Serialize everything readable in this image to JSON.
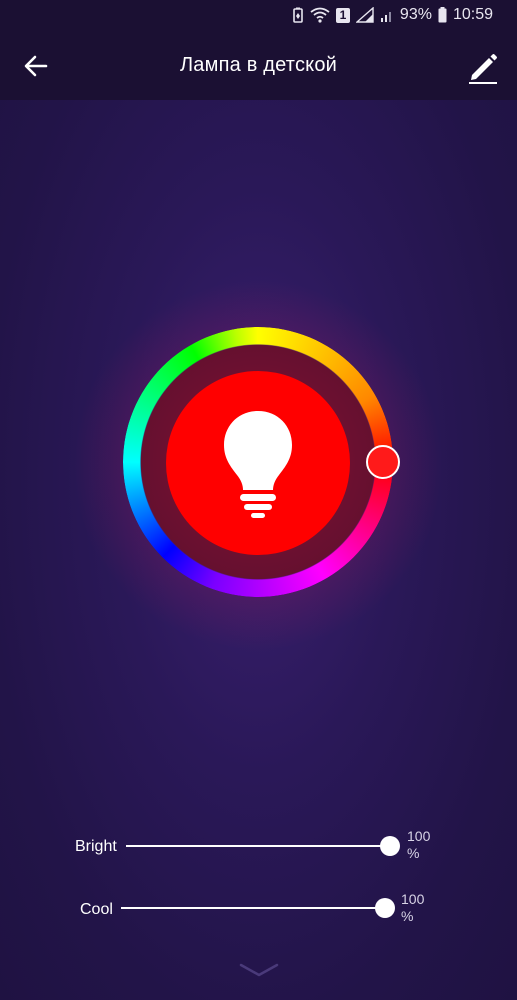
{
  "status_bar": {
    "battery": "93%",
    "time": "10:59",
    "sim_label": "1",
    "icons": [
      "battery-saver-icon",
      "wifi-icon",
      "sim-badge-icon",
      "signal-icon",
      "signal-weak-icon",
      "battery-icon"
    ]
  },
  "header": {
    "title": "Лампа в детской",
    "back_icon": "arrow-left-icon",
    "edit_icon": "pencil-icon"
  },
  "color_wheel": {
    "selected_color": "#ff0000",
    "lamp_icon": "lightbulb-icon"
  },
  "sliders": {
    "bright": {
      "label": "Bright",
      "value": "100",
      "unit": "%",
      "level": 1.0
    },
    "cool": {
      "label": "Cool",
      "value": "100",
      "unit": "%",
      "level": 1.0
    }
  },
  "footer": {
    "expand_icon": "chevron-down-icon"
  }
}
